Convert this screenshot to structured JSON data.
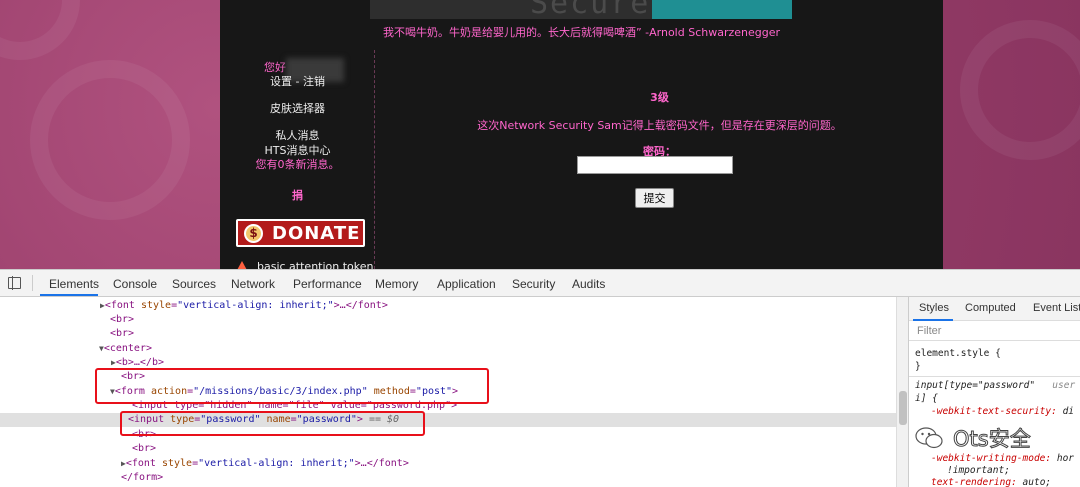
{
  "site": {
    "quote": "我不喝牛奶。牛奶是给婴儿用的。长大后就得喝啤酒” -Arnold Schwarzenegger",
    "banner_text": "Secure",
    "sidebar": {
      "greeting": "您好",
      "settings_logout": "设置 - 注销",
      "skin_selector": "皮肤选择器",
      "private_messages": "私人消息",
      "hts_message_center": "HTS消息中心",
      "new_messages": "您有0条新消息。",
      "donate_heading": "捐",
      "donate_button": "DONATE",
      "donate_coin": "$",
      "bat_text": "basic attention token"
    },
    "main": {
      "level": "3级",
      "description": "这次Network Security Sam记得上载密码文件，但是存在更深层的问题。",
      "password_label": "密码：",
      "password_value": "",
      "submit": "提交"
    }
  },
  "devtools": {
    "tabs": [
      "Elements",
      "Console",
      "Sources",
      "Network",
      "Performance",
      "Memory",
      "Application",
      "Security",
      "Audits"
    ],
    "active_tab": "Elements",
    "code": {
      "l1_tag": "<font",
      "l1_attr": "style",
      "l1_val": "\"vertical-align: inherit;\"",
      "l1_end": ">…</font>",
      "br": "<br>",
      "center": "<center>",
      "b": "<b>…</b>",
      "form_open": "<form",
      "form_action_attr": "action",
      "form_action_val": "\"/missions/basic/3/index.php\"",
      "form_method_attr": "method",
      "form_method_val": "\"post\"",
      "form_close_bracket": ">",
      "hidden_input": "<input type=\"hidden\" name=\"file\" value=\"password.php\">",
      "input_open": "<input",
      "input_type_attr": "type",
      "input_type_val": "\"password\"",
      "input_name_attr": "name",
      "input_name_val": "\"password\"",
      "input_end": ">",
      "selected_marker": "== $0",
      "form_end": "</form>"
    },
    "styles": {
      "tabs": [
        "Styles",
        "Computed",
        "Event Liste"
      ],
      "filter_placeholder": "Filter",
      "element_style": "element.style {",
      "close_brace": "}",
      "rule_selector": "input[type=\"password\"",
      "rule_selector_2": "i] {",
      "rule_source": "user",
      "prop1": "-webkit-text-security:",
      "prop1_val": "di",
      "prop2": "-webkit-writing-mode:",
      "prop2_val": "hor",
      "important": "!important;",
      "prop3": "text-rendering:",
      "prop3_val": "auto;"
    }
  },
  "watermark": "Ots安全"
}
